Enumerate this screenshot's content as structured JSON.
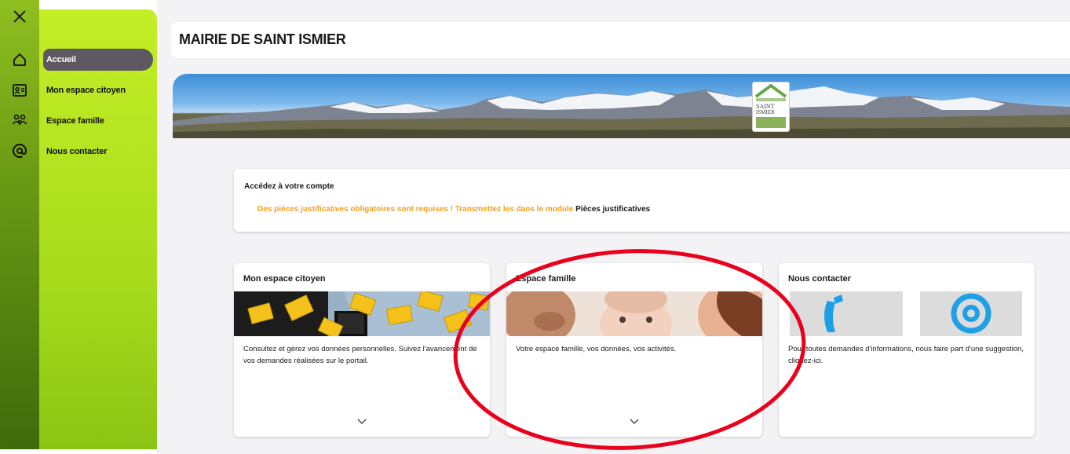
{
  "rail": {
    "icons": [
      "close-icon",
      "home-icon",
      "id-card-icon",
      "family-icon",
      "at-sign-icon"
    ]
  },
  "sidebar": {
    "items": [
      {
        "label": "Accueil",
        "active": true
      },
      {
        "label": "Mon espace citoyen",
        "active": false
      },
      {
        "label": "Espace famille",
        "active": false
      },
      {
        "label": "Nous contacter",
        "active": false
      }
    ]
  },
  "header": {
    "title": "MAIRIE DE SAINT ISMIER"
  },
  "banner": {
    "logo_text_line1": "SAINT",
    "logo_text_line2": "ISMIER"
  },
  "account": {
    "title": "Accédez à votre compte",
    "warning": "Des pièces justificatives obligatoires sont requises ! Transmettez les dans le module ",
    "warning_link": "Pièces justificatives"
  },
  "cards": [
    {
      "title": "Mon espace citoyen",
      "text": "Consultez et gérez vos données personnelles. Suivez l'avancement de vos demandes réalisées sur le portail."
    },
    {
      "title": "Espace famille",
      "text": "Votre espace famille, vos données, vos activités."
    },
    {
      "title": "Nous contacter",
      "text": "Pour toutes demandes d'informations, nous faire part d'une suggestion, cliquez-ici."
    }
  ],
  "colors": {
    "rail_green": "#6a9a14",
    "menu_lime": "#c4ee26",
    "active_item": "#5e5862",
    "warning_orange": "#f0a020",
    "annotation_red": "#e8001c",
    "contact_blue": "#1ea0e6"
  }
}
